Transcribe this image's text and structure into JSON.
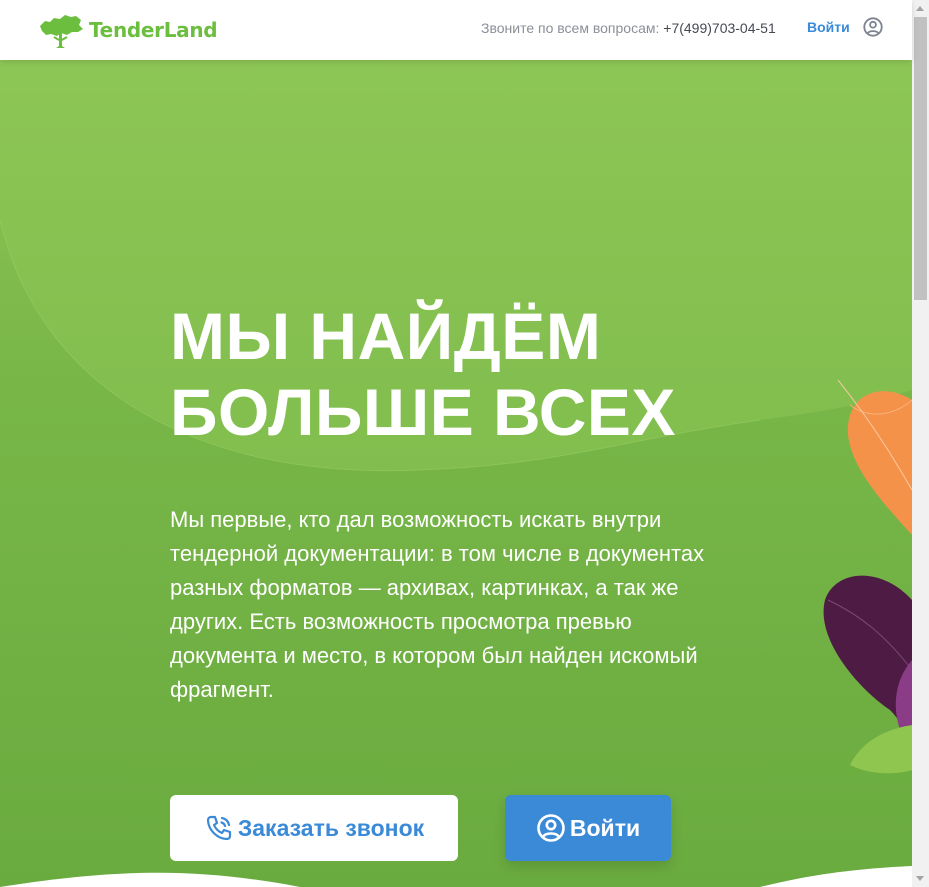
{
  "header": {
    "logo_text": "TenderLand",
    "call_prefix": "Звоните по всем вопросам: ",
    "phone": "+7(499)703-04-51",
    "login_label": "Войти",
    "icons": {
      "logo": "tree-map-logo-icon",
      "login": "user-circle-icon"
    }
  },
  "hero": {
    "title_line1": "МЫ НАЙДЁМ",
    "title_line2": "БОЛЬШЕ ВСЕХ",
    "description": "Мы первые, кто дал возможность искать внутри тендерной документации: в том числе в документах разных форматов — архивах, картинках, а так же других. Есть возможность просмотра превью документа и место, в котором был найден искомый фрагмент.",
    "call_button_label": "Заказать звонок",
    "login_button_label": "Войти",
    "icons": {
      "call": "phone-call-icon",
      "login": "user-circle-icon"
    }
  },
  "colors": {
    "brand_green": "#6cbf3e",
    "hero_green": "#7ab749",
    "accent_blue": "#3a8ad8",
    "leaf_orange": "#f5924a",
    "leaf_purple": "#5a1f4e"
  }
}
